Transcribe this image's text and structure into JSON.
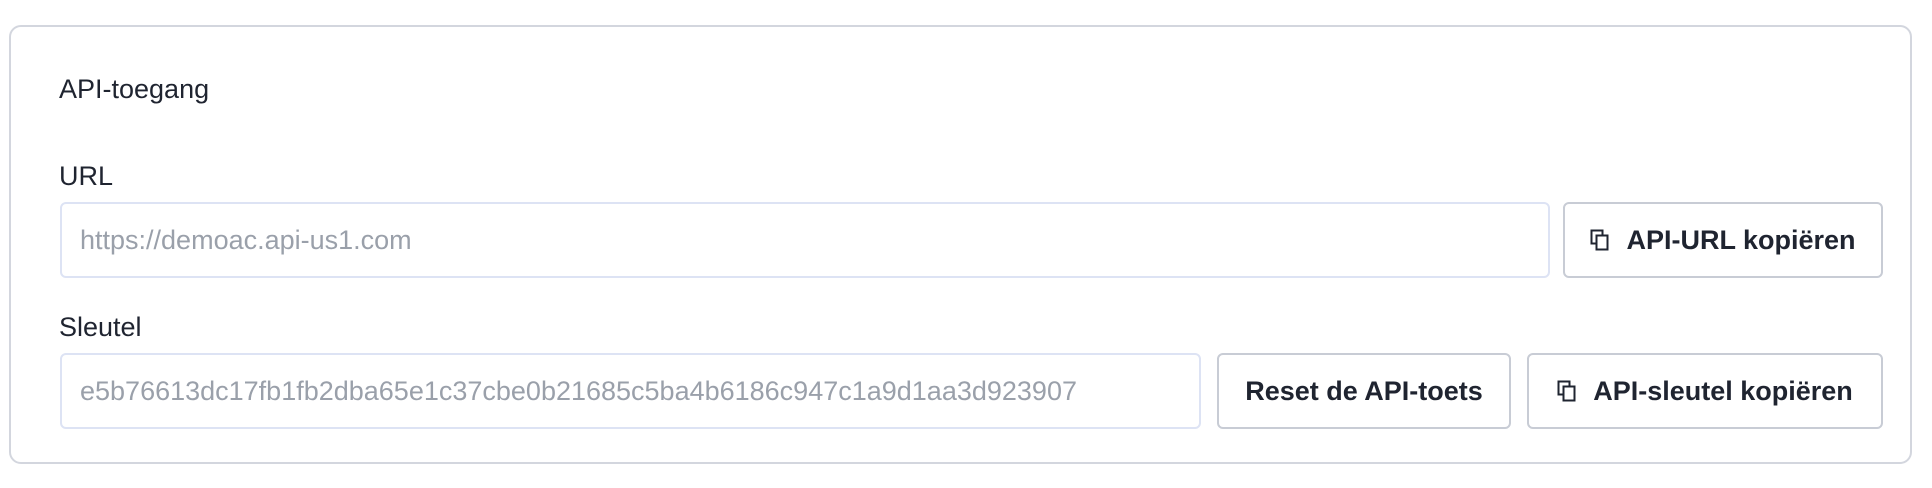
{
  "section": {
    "title": "API-toegang"
  },
  "url": {
    "label": "URL",
    "placeholder": "https://demoac.api-us1.com",
    "copy_button_label": "API-URL kopiëren"
  },
  "key": {
    "label": "Sleutel",
    "value": "e5b76613dc17fb1fb2dba65e1c37cbe0b21685c5ba4b6186c947c1a9d1aa3d923907",
    "reset_button_label": "Reset de API-toets",
    "copy_button_label": "API-sleutel kopiëren"
  },
  "icons": {
    "copy": "copy-icon"
  },
  "colors": {
    "card_border": "#d3d6de",
    "field_border": "#dde3f4",
    "button_border": "#c8ccd5",
    "placeholder_text": "#9aa0aa",
    "text": "#1f2430"
  }
}
